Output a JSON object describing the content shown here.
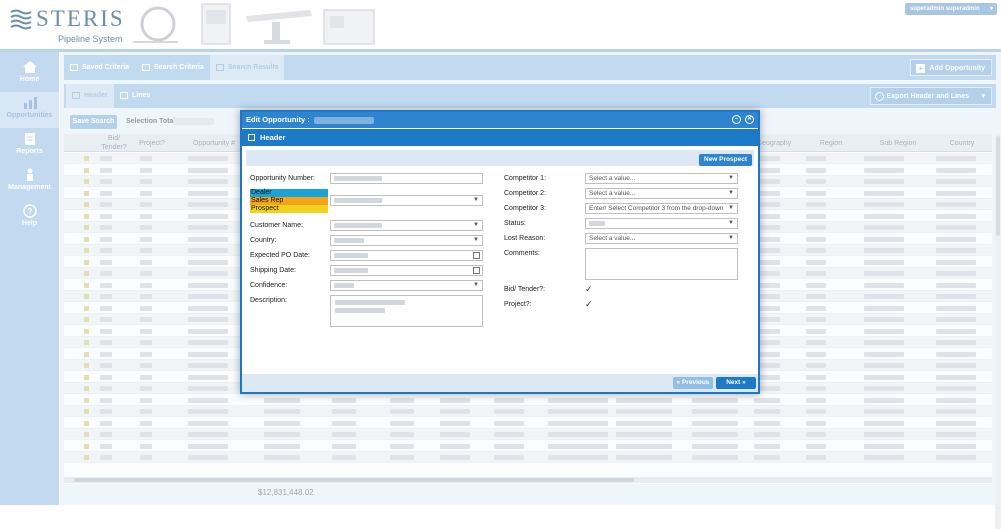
{
  "app": {
    "brand": "STERIS",
    "subtitle": "Pipeline System",
    "user_label": "superadmin superadmin"
  },
  "sidebar": {
    "items": [
      {
        "label": "Home",
        "icon": "home-icon"
      },
      {
        "label": "Opportunities",
        "icon": "chart-icon"
      },
      {
        "label": "Reports",
        "icon": "document-icon"
      },
      {
        "label": "Management",
        "icon": "person-icon"
      },
      {
        "label": "Help",
        "icon": "help-icon"
      }
    ]
  },
  "tabs": {
    "saved": "Saved Criteria",
    "search": "Search Criteria",
    "results": "Search Results",
    "add": "Add Opportunity"
  },
  "subtabs": {
    "header": "Header",
    "lines": "Lines",
    "export": "Export Header and Lines"
  },
  "toolbar": {
    "save_search": "Save Search",
    "selection_total": "Selection Total"
  },
  "grid": {
    "columns": [
      "Bid/ Tender?",
      "Project?",
      "Opportunity #",
      "Geography",
      "Region",
      "Sub Region",
      "Country"
    ],
    "total": "$12,831,448.02"
  },
  "modal": {
    "title": "Edit Opportunity :",
    "section": "Header",
    "new_prospect": "New Prospect",
    "labels": {
      "opportunity_number": "Opportunity Number:",
      "customer_name": "Customer Name:",
      "country": "Country:",
      "expected_po": "Expected PO Date:",
      "shipping_date": "Shipping Date:",
      "confidence": "Confidence:",
      "description": "Description:",
      "competitor1": "Competitor 1:",
      "competitor2": "Competitor 2:",
      "competitor3": "Competitor 3:",
      "status": "Status:",
      "lost_reason": "Lost Reason:",
      "comments": "Comments:",
      "bid_tender": "Bid/ Tender?:",
      "project": "Project?:"
    },
    "type_legend": [
      {
        "label": "Dealer",
        "color": "#1aa3d9"
      },
      {
        "label": "Sales Rep",
        "color": "#f5a31a"
      },
      {
        "label": "Prospect",
        "color": "#f2d21c"
      }
    ],
    "competitor1_value": "Select a value...",
    "competitor2_value": "Select a value...",
    "competitor3_value": "Enter/ Select Competitor 3 from the drop-down",
    "lost_reason_value": "Select a value...",
    "prev": "« Previous",
    "next": "Next »"
  }
}
